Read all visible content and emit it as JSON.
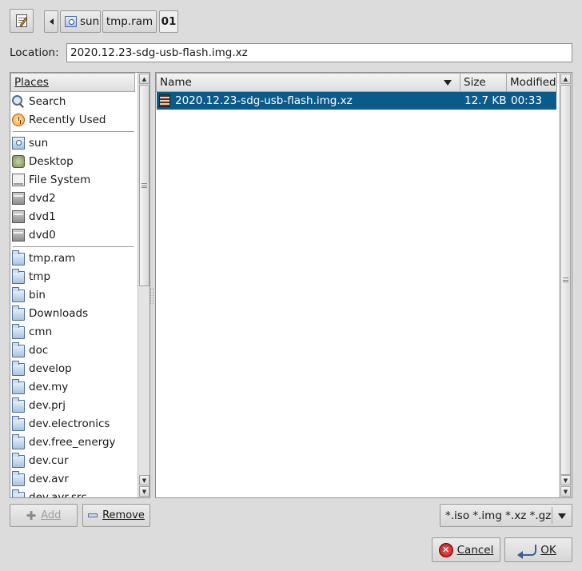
{
  "toolbar": {
    "edit_icon": "edit-path-icon",
    "back_icon": "left-arrow-icon",
    "breadcrumbs": [
      "sun",
      "tmp.ram",
      "01"
    ]
  },
  "location": {
    "label": "Location:",
    "value": "2020.12.23-sdg-usb-flash.img.xz"
  },
  "places": {
    "header": "Places",
    "items_top": [
      {
        "label": "Search",
        "icon": "search-icon"
      },
      {
        "label": "Recently Used",
        "icon": "recent-icon"
      }
    ],
    "items_devices": [
      {
        "label": "sun",
        "icon": "home-icon"
      },
      {
        "label": "Desktop",
        "icon": "desktop-icon"
      },
      {
        "label": "File System",
        "icon": "filesystem-icon"
      },
      {
        "label": "dvd2",
        "icon": "drive-icon"
      },
      {
        "label": "dvd1",
        "icon": "drive-icon"
      },
      {
        "label": "dvd0",
        "icon": "drive-icon"
      }
    ],
    "bookmarks": [
      "tmp.ram",
      "tmp",
      "bin",
      "Downloads",
      "cmn",
      "doc",
      "develop",
      "dev.my",
      "dev.prj",
      "dev.electronics",
      "dev.free_energy",
      "dev.cur",
      "dev.avr",
      "dev.avr.src"
    ],
    "add_label": "Add",
    "remove_label": "Remove"
  },
  "files": {
    "columns": {
      "name": "Name",
      "size": "Size",
      "modified": "Modified"
    },
    "rows": [
      {
        "name": "2020.12.23-sdg-usb-flash.img.xz",
        "size": "12.7 KB",
        "modified": "00:33",
        "selected": true
      }
    ]
  },
  "filter": {
    "value": "*.iso *.img *.xz *.gz"
  },
  "actions": {
    "cancel_label": "Cancel",
    "ok_label": "OK"
  },
  "colors": {
    "selection": "#0a5a8a",
    "background": "#dcdcdc"
  }
}
